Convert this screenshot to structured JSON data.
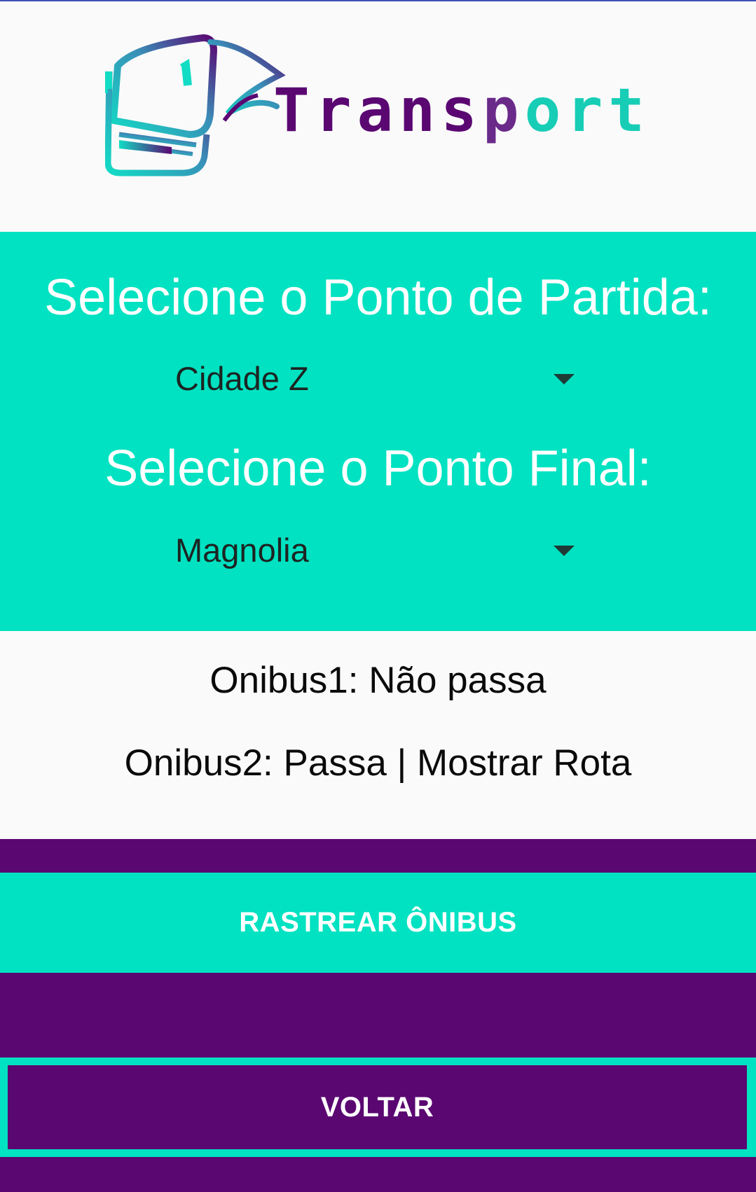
{
  "app": {
    "logo_text": "Transport"
  },
  "colors": {
    "accent_teal": "#00e2c1",
    "accent_purple": "#5a0772",
    "background": "#fafafa"
  },
  "origin": {
    "heading": "Selecione o Ponto de Partida:",
    "selected": "Cidade Z",
    "icon": "dropdown-arrow-icon"
  },
  "destination": {
    "heading": "Selecione o Ponto Final:",
    "selected": "Magnolia",
    "icon": "dropdown-arrow-icon"
  },
  "results": {
    "bus1": "Onibus1: Não passa",
    "bus2_prefix": "Onibus2: Passa | ",
    "bus2_link": "Mostrar Rota"
  },
  "buttons": {
    "track": "RASTREAR ÔNIBUS",
    "back": "VOLTAR"
  }
}
